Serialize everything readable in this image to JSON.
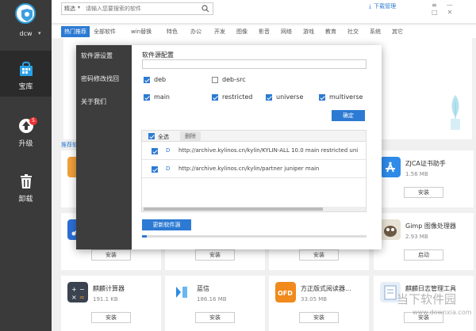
{
  "sidebar": {
    "username": "dcw",
    "items": [
      {
        "label": "宝库",
        "icon": "shopping-bag-icon"
      },
      {
        "label": "升级",
        "icon": "upload-icon",
        "badge": "5"
      },
      {
        "label": "卸载",
        "icon": "trash-icon"
      }
    ]
  },
  "topbar": {
    "search_scope": "精选",
    "search_placeholder": "请输入您要搜索的软件",
    "download_manager": "下载管理"
  },
  "tabs": [
    "热门推荐",
    "全部软件",
    "win替换",
    "特色",
    "办公",
    "开发",
    "图像",
    "影音",
    "网络",
    "游戏",
    "教育",
    "社交",
    "系统",
    "其它"
  ],
  "section_title": "推荐软",
  "cards": [
    {
      "name": "",
      "size": "",
      "button": "安装"
    },
    {
      "name": "ZJCA证书助手",
      "size": "1.56 MB",
      "button": "安装"
    },
    {
      "name": "",
      "size": "",
      "button": "安装"
    },
    {
      "name": "",
      "size": "",
      "button": "安装"
    },
    {
      "name": "",
      "size": "",
      "button": "安装"
    },
    {
      "name": "Gimp 图像处理器",
      "size": "2.93 MB",
      "button": "启动"
    },
    {
      "name": "麒麟计算器",
      "size": "191.1 KB",
      "button": "安装"
    },
    {
      "name": "蓝信",
      "size": "186.16 MB",
      "button": "安装"
    },
    {
      "name": "方正版式阅读器...",
      "size": "33.05 MB",
      "button": "安装"
    },
    {
      "name": "麒麟日志管理工具",
      "size": "",
      "button": "安装"
    }
  ],
  "dialog": {
    "menu": [
      "软件源设置",
      "密码修改找回",
      "关于我们"
    ],
    "title": "软件源配置",
    "checkboxes": [
      {
        "label": "deb",
        "checked": true
      },
      {
        "label": "deb-src",
        "checked": false
      },
      {
        "label": "main",
        "checked": true
      },
      {
        "label": "restricted",
        "checked": true
      },
      {
        "label": "universe",
        "checked": true
      },
      {
        "label": "multiverse",
        "checked": true
      }
    ],
    "confirm": "确定",
    "select_all": "全选",
    "delete": "删除",
    "sources": [
      {
        "type": "D",
        "url": "http://archive.kylinos.cn/kylin/KYLIN-ALL 10.0 main restricted uni"
      },
      {
        "type": "D",
        "url": "http://archive.kylinos.cn/kylin/partner juniper main"
      }
    ],
    "update_button": "更新软件源",
    "progress": 0.02
  },
  "watermark": {
    "text": "当下软件园",
    "url": "www.downxia.com"
  }
}
